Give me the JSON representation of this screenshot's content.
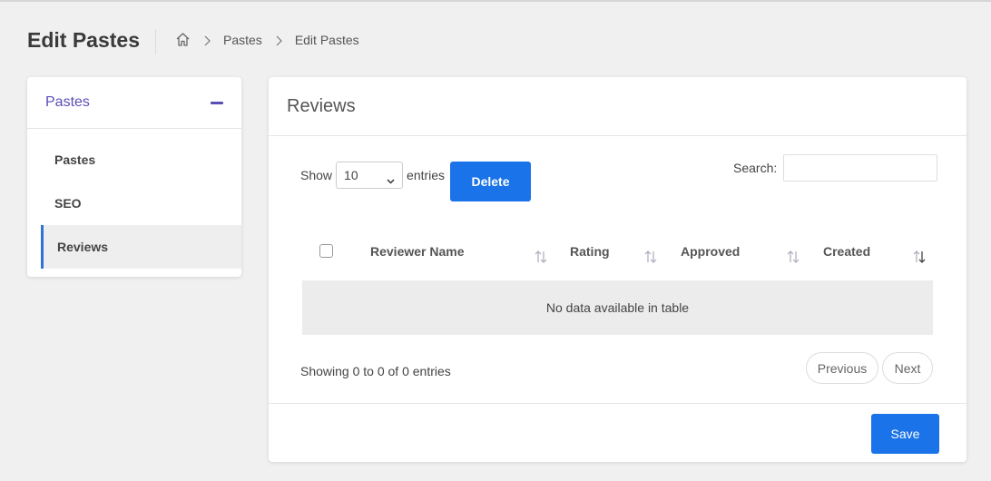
{
  "header": {
    "page_title": "Edit Pastes",
    "breadcrumb": [
      "Pastes",
      "Edit Pastes"
    ]
  },
  "sidebar": {
    "title": "Pastes",
    "items": [
      {
        "label": "Pastes",
        "active": false
      },
      {
        "label": "SEO",
        "active": false
      },
      {
        "label": "Reviews",
        "active": true
      }
    ]
  },
  "main": {
    "title": "Reviews",
    "show_label": "Show",
    "entries_label": "entries",
    "length_value": "10",
    "delete_label": "Delete",
    "search_label": "Search:",
    "search_value": "",
    "columns": [
      "Reviewer Name",
      "Rating",
      "Approved",
      "Created"
    ],
    "empty_text": "No data available in table",
    "info_text": "Showing 0 to 0 of 0 entries",
    "prev_label": "Previous",
    "next_label": "Next",
    "save_label": "Save"
  },
  "colors": {
    "accent": "#1a73e8",
    "sidebar_title": "#5a4fb4",
    "active_marker": "#2f72d8"
  }
}
